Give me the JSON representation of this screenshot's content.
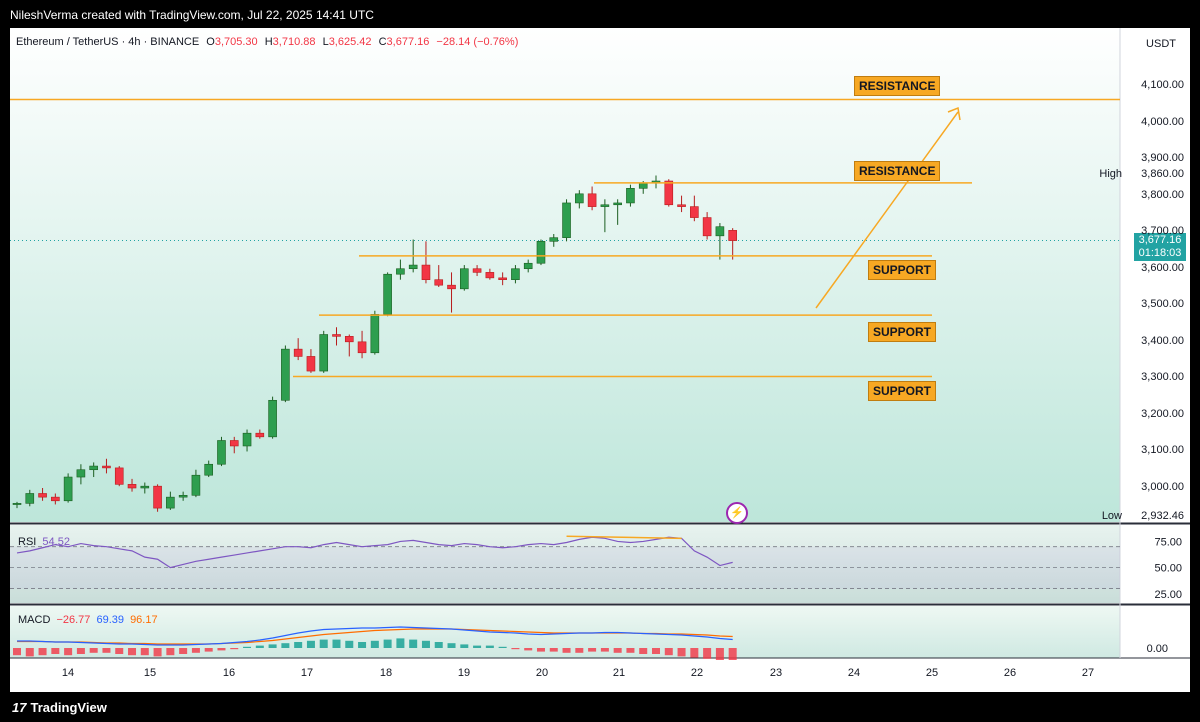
{
  "credit": "NileshVerma created with TradingView.com, Jul 22, 2025 14:41 UTC",
  "legend": {
    "symbol": "Ethereum / TetherUS · 4h · BINANCE",
    "o_label": "O",
    "o": "3,705.30",
    "h_label": "H",
    "h": "3,710.88",
    "l_label": "L",
    "l": "3,625.42",
    "c_label": "C",
    "c": "3,677.16",
    "change": "−28.14 (−0.76%)"
  },
  "currency": "USDT",
  "high_label": "High",
  "low_label": "Low",
  "high_value": "3,860.00",
  "low_value": "2,932.46",
  "last_price": "3,677.16",
  "countdown": "01:18:03",
  "brand": "TradingView",
  "colors": {
    "up": "#26a69a",
    "up_body": "#2e9e4f",
    "down": "#f23645",
    "level": "#f7a823",
    "rsi": "#7e57c2",
    "macd": "#2962ff",
    "signal": "#ff6d00"
  },
  "levels": [
    {
      "label": "RESISTANCE",
      "price": 4063
    },
    {
      "label": "RESISTANCE",
      "price": 3835
    },
    {
      "label": "SUPPORT",
      "price": 3635
    },
    {
      "label": "SUPPORT",
      "price": 3473
    },
    {
      "label": "SUPPORT",
      "price": 3305
    }
  ],
  "chart_data": {
    "type": "candlestick",
    "title": "Ethereum / TetherUS · 4h · BINANCE",
    "timeframe": "4h",
    "ylabel": "USDT",
    "ylim": [
      2900,
      4170
    ],
    "yticks": [
      "4,100.00",
      "4,000.00",
      "3,900.00",
      "3,800.00",
      "3,700.00",
      "3,600.00",
      "3,500.00",
      "3,400.00",
      "3,300.00",
      "3,200.00",
      "3,100.00",
      "3,000.00"
    ],
    "xticks": [
      "14",
      "15",
      "16",
      "17",
      "18",
      "19",
      "20",
      "21",
      "22",
      "23",
      "24",
      "25",
      "26",
      "27"
    ],
    "candles": [
      [
        2955,
        2962,
        2945,
        2958
      ],
      [
        2958,
        2995,
        2950,
        2985
      ],
      [
        2985,
        3000,
        2965,
        2975
      ],
      [
        2975,
        2985,
        2955,
        2965
      ],
      [
        2965,
        3040,
        2960,
        3030
      ],
      [
        3030,
        3065,
        3010,
        3050
      ],
      [
        3050,
        3070,
        3030,
        3060
      ],
      [
        3060,
        3080,
        3040,
        3055
      ],
      [
        3055,
        3060,
        3005,
        3010
      ],
      [
        3010,
        3025,
        2990,
        3000
      ],
      [
        3000,
        3015,
        2985,
        3005
      ],
      [
        3005,
        3010,
        2935,
        2945
      ],
      [
        2945,
        2990,
        2940,
        2975
      ],
      [
        2975,
        2990,
        2965,
        2980
      ],
      [
        2980,
        3050,
        2975,
        3035
      ],
      [
        3035,
        3075,
        3030,
        3065
      ],
      [
        3065,
        3140,
        3060,
        3130
      ],
      [
        3130,
        3140,
        3095,
        3115
      ],
      [
        3115,
        3160,
        3100,
        3150
      ],
      [
        3150,
        3160,
        3135,
        3140
      ],
      [
        3140,
        3250,
        3135,
        3240
      ],
      [
        3240,
        3390,
        3235,
        3380
      ],
      [
        3380,
        3410,
        3350,
        3360
      ],
      [
        3360,
        3380,
        3315,
        3320
      ],
      [
        3320,
        3430,
        3315,
        3420
      ],
      [
        3420,
        3440,
        3390,
        3415
      ],
      [
        3415,
        3420,
        3360,
        3400
      ],
      [
        3400,
        3430,
        3355,
        3370
      ],
      [
        3370,
        3485,
        3365,
        3475
      ],
      [
        3475,
        3590,
        3470,
        3585
      ],
      [
        3585,
        3625,
        3570,
        3600
      ],
      [
        3600,
        3680,
        3590,
        3610
      ],
      [
        3610,
        3675,
        3560,
        3570
      ],
      [
        3570,
        3610,
        3550,
        3555
      ],
      [
        3555,
        3590,
        3480,
        3545
      ],
      [
        3545,
        3610,
        3540,
        3600
      ],
      [
        3600,
        3610,
        3580,
        3590
      ],
      [
        3590,
        3600,
        3570,
        3575
      ],
      [
        3575,
        3590,
        3555,
        3570
      ],
      [
        3570,
        3610,
        3560,
        3600
      ],
      [
        3600,
        3625,
        3590,
        3615
      ],
      [
        3615,
        3680,
        3610,
        3675
      ],
      [
        3675,
        3695,
        3660,
        3685
      ],
      [
        3685,
        3790,
        3675,
        3780
      ],
      [
        3780,
        3815,
        3765,
        3805
      ],
      [
        3805,
        3825,
        3760,
        3770
      ],
      [
        3770,
        3790,
        3700,
        3775
      ],
      [
        3775,
        3790,
        3720,
        3780
      ],
      [
        3780,
        3830,
        3770,
        3820
      ],
      [
        3820,
        3840,
        3805,
        3835
      ],
      [
        3835,
        3855,
        3820,
        3840
      ],
      [
        3840,
        3845,
        3770,
        3775
      ],
      [
        3775,
        3800,
        3755,
        3770
      ],
      [
        3770,
        3800,
        3730,
        3740
      ],
      [
        3740,
        3755,
        3680,
        3690
      ],
      [
        3690,
        3725,
        3625,
        3715
      ],
      [
        3705,
        3711,
        3625,
        3677
      ]
    ],
    "rsi": {
      "label": "RSI",
      "value": "54.52",
      "ticks": [
        "75.00",
        "50.00",
        "25.00"
      ],
      "range": [
        20,
        85
      ]
    },
    "macd": {
      "label": "MACD",
      "values": [
        "−26.77",
        "69.39",
        "96.17"
      ],
      "ticks": [
        "0.00"
      ]
    },
    "annotations": [
      "RESISTANCE",
      "RESISTANCE",
      "SUPPORT",
      "SUPPORT",
      "SUPPORT"
    ],
    "grid": false
  }
}
